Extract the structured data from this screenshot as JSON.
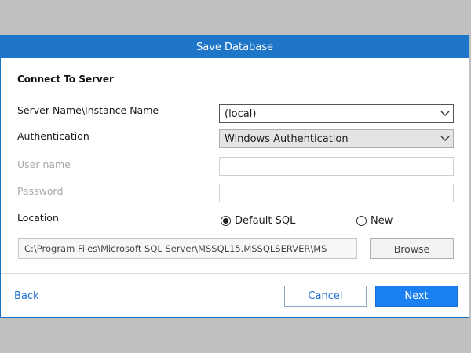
{
  "dialog": {
    "title": "Save Database",
    "section_title": "Connect To Server"
  },
  "fields": {
    "server_label": "Server Name\\Instance Name",
    "server_value": "(local)",
    "auth_label": "Authentication",
    "auth_value": "Windows Authentication",
    "username_label": "User name",
    "username_value": "",
    "password_label": "Password",
    "password_value": ""
  },
  "location": {
    "label": "Location",
    "option_default": "Default SQL",
    "option_new": "New",
    "selected": "Default SQL",
    "path": "C:\\Program Files\\Microsoft SQL Server\\MSSQL15.MSSQLSERVER\\MS",
    "browse_label": "Browse"
  },
  "footer": {
    "back_label": "Back",
    "cancel_label": "Cancel",
    "next_label": "Next"
  },
  "icons": {
    "dropdown": "chevron-down-icon"
  },
  "colors": {
    "titlebar": "#1f76c9",
    "accent": "#1a7ff0",
    "link": "#1f6fcf"
  }
}
